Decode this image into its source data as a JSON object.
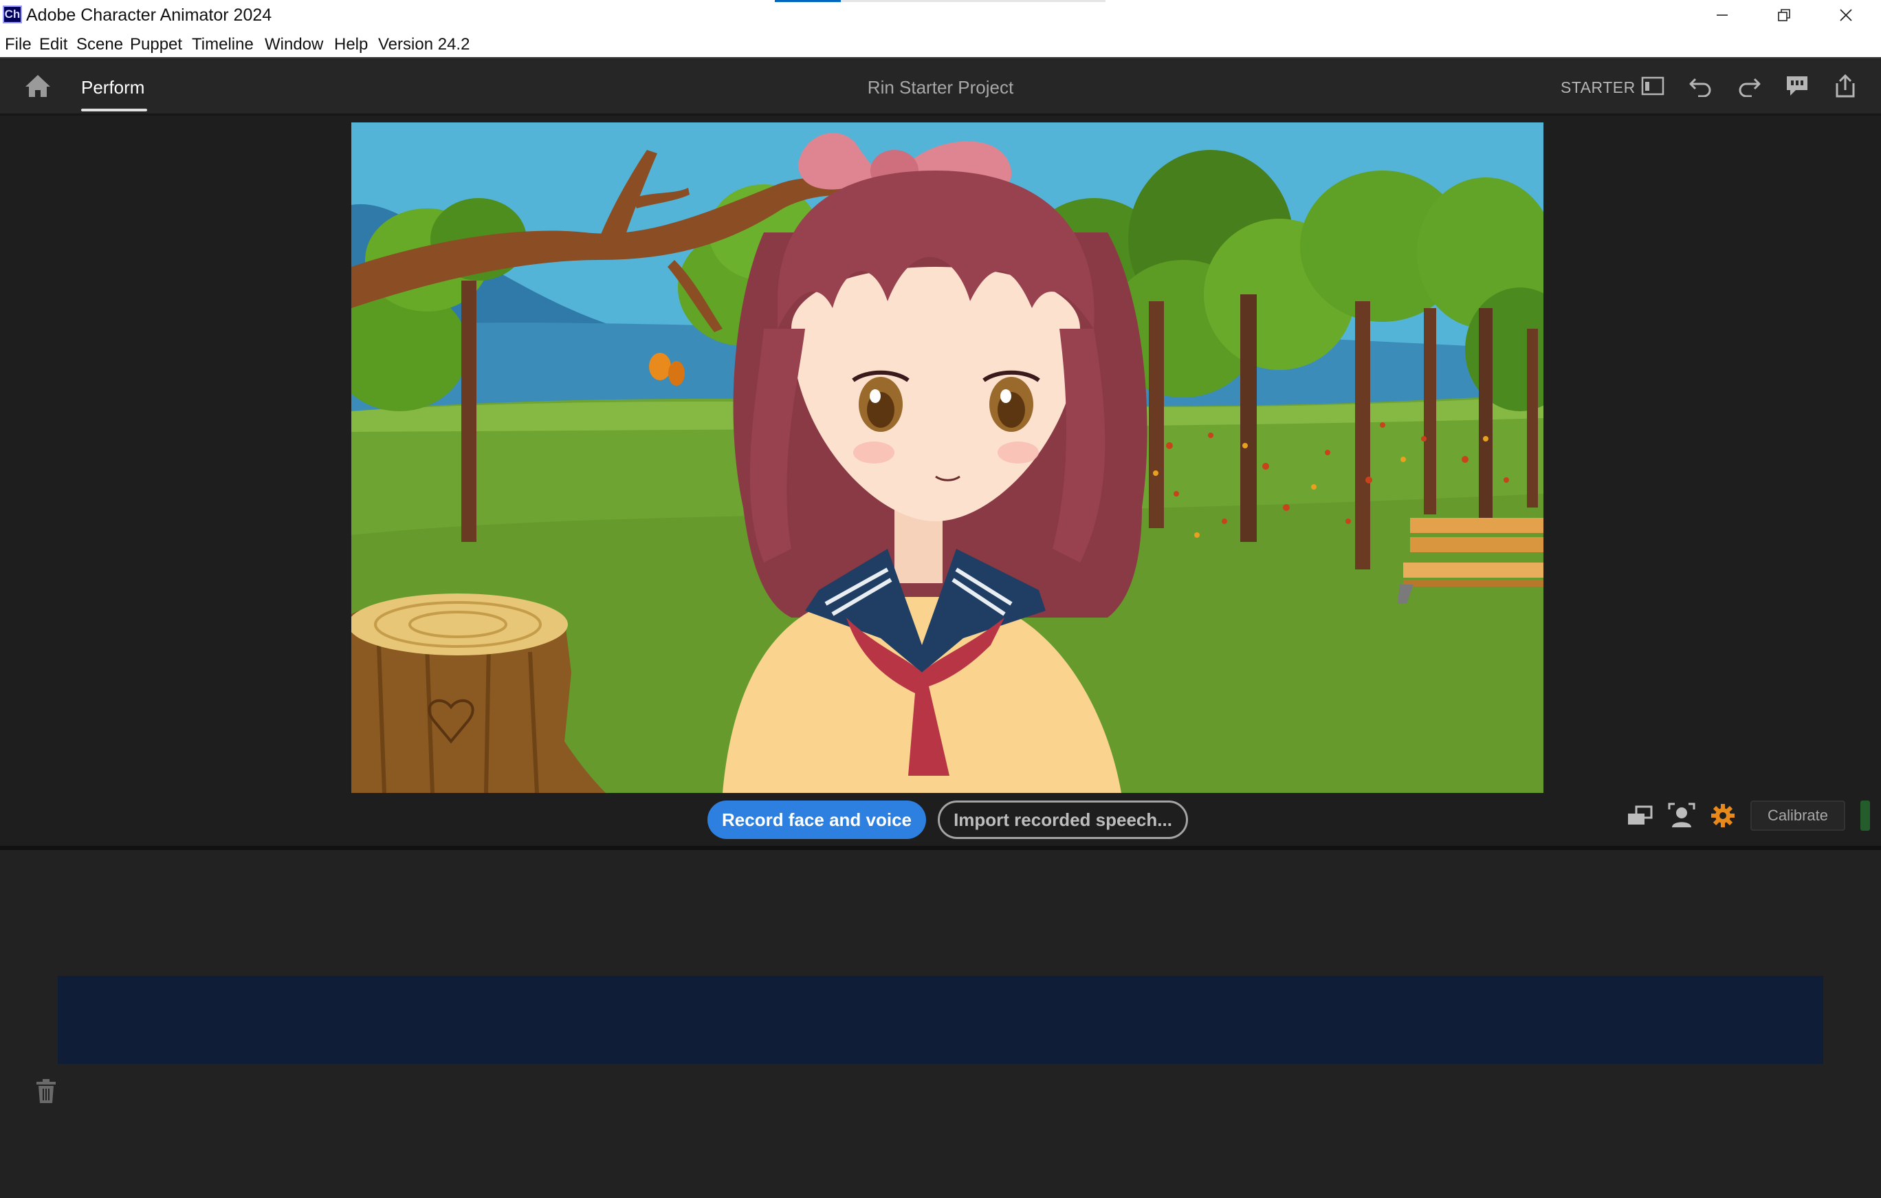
{
  "window": {
    "app_badge": "Ch",
    "title": "Adobe Character Animator 2024",
    "controls": {
      "minimize": "minimize-icon",
      "maximize": "restore-icon",
      "close": "close-icon"
    }
  },
  "menu": {
    "items": [
      "File",
      "Edit",
      "Scene",
      "Puppet",
      "Timeline",
      "Window",
      "Help",
      "Version 24.2"
    ]
  },
  "header": {
    "home_icon": "home-icon",
    "mode_tab": "Perform",
    "project_title": "Rin Starter Project",
    "tier": "STARTER",
    "icons": [
      "workspace-panel-icon",
      "undo-icon",
      "redo-icon",
      "feedback-icon",
      "export-icon"
    ]
  },
  "stage": {
    "record_button": "Record face and voice",
    "import_button": "Import recorded speech...",
    "tool_icons": [
      "camera-view-icon",
      "face-tracking-icon",
      "settings-gear-icon"
    ],
    "calibrate_button": "Calibrate"
  },
  "timeline": {
    "trash_icon": "trash-icon"
  },
  "colors": {
    "accent": "#2d7fe0",
    "gear": "#e8891c",
    "take_lane": "#0f1e36",
    "mic_level": "#245c2c"
  }
}
